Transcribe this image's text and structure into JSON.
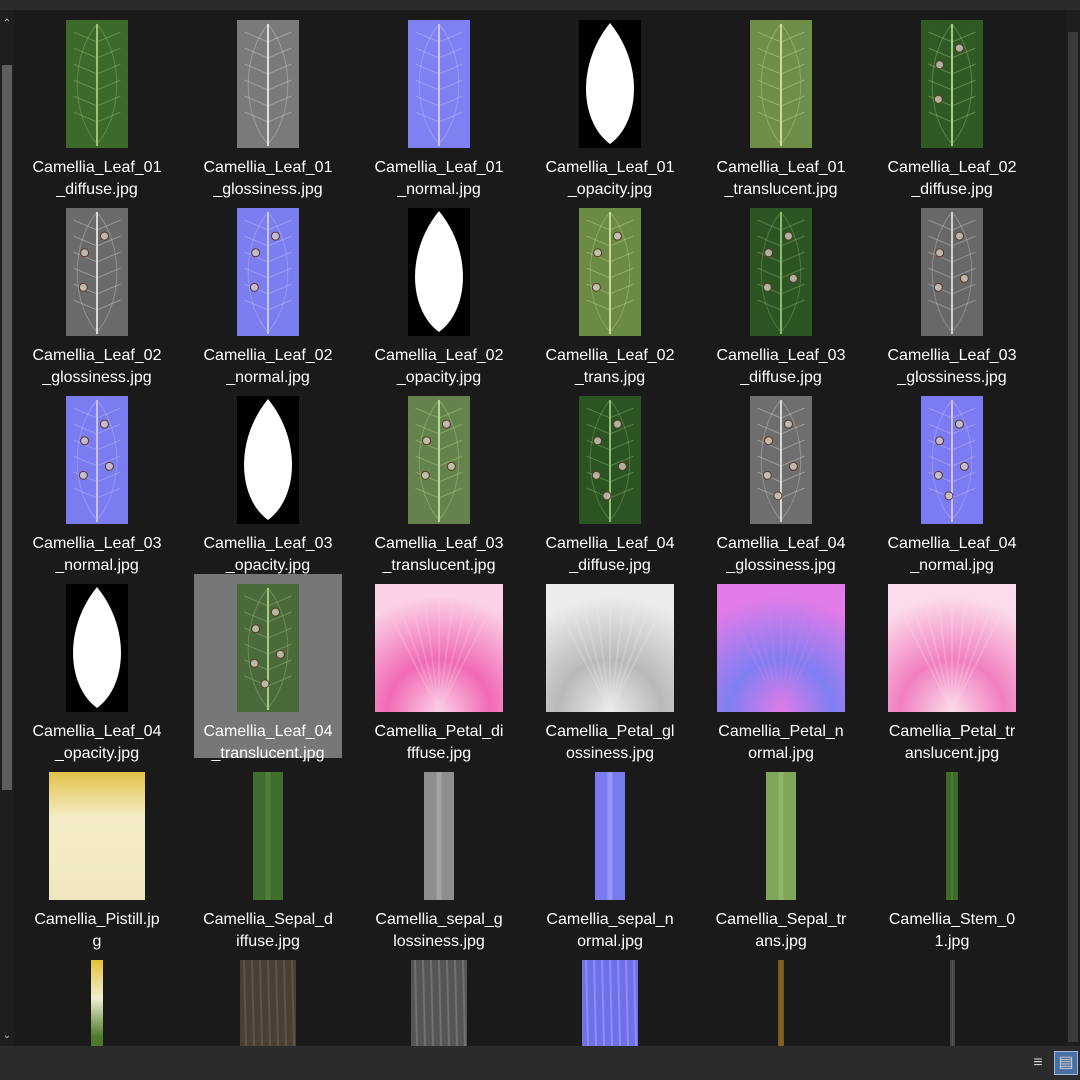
{
  "window": {
    "scroll_up_arrow": "^",
    "scroll_down_arrow": "v"
  },
  "files": [
    {
      "line1": "Camellia_Leaf_01",
      "line2": "_diffuse.jpg",
      "type": "leafrect",
      "bg": "#3b6a2a",
      "vein": "#9fc27a",
      "spots": 0
    },
    {
      "line1": "Camellia_Leaf_01",
      "line2": "_glossiness.jpg",
      "type": "leafrect",
      "bg": "#7a7a7a",
      "vein": "#dedede",
      "spots": 0
    },
    {
      "line1": "Camellia_Leaf_01",
      "line2": "_normal.jpg",
      "type": "leafrect",
      "bg": "#7f80f2",
      "vein": "#c8c8ff",
      "spots": 0
    },
    {
      "line1": "Camellia_Leaf_01",
      "line2": "_opacity.jpg",
      "type": "opacity",
      "bg": "#000000",
      "vein": "#ffffff",
      "spots": 0
    },
    {
      "line1": "Camellia_Leaf_01",
      "line2": "_translucent.jpg",
      "type": "leafrect",
      "bg": "#6f8e4a",
      "vein": "#c9dba0",
      "spots": 0
    },
    {
      "line1": "Camellia_Leaf_02",
      "line2": "_diffuse.jpg",
      "type": "leafrect",
      "bg": "#2f5a24",
      "vein": "#a9cf86",
      "spots": 3
    },
    {
      "line1": "Camellia_Leaf_02",
      "line2": "_glossiness.jpg",
      "type": "leafrect",
      "bg": "#6a6a6a",
      "vein": "#d8d8d8",
      "spots": 3
    },
    {
      "line1": "Camellia_Leaf_02",
      "line2": "_normal.jpg",
      "type": "leafrect",
      "bg": "#7c7ef0",
      "vein": "#c6c6ff",
      "spots": 3
    },
    {
      "line1": "Camellia_Leaf_02",
      "line2": "_opacity.jpg",
      "type": "opacity",
      "bg": "#000000",
      "vein": "#ffffff",
      "spots": 0
    },
    {
      "line1": "Camellia_Leaf_02",
      "line2": "_trans.jpg",
      "type": "leafrect",
      "bg": "#6b8a46",
      "vein": "#c6da9c",
      "spots": 3
    },
    {
      "line1": "Camellia_Leaf_03",
      "line2": "_diffuse.jpg",
      "type": "leafrect",
      "bg": "#2d5523",
      "vein": "#8fb872",
      "spots": 4
    },
    {
      "line1": "Camellia_Leaf_03",
      "line2": "_glossiness.jpg",
      "type": "leafrect",
      "bg": "#686868",
      "vein": "#d0d0d0",
      "spots": 4
    },
    {
      "line1": "Camellia_Leaf_03",
      "line2": "_normal.jpg",
      "type": "leafrect",
      "bg": "#7a7cf0",
      "vein": "#c3c4ff",
      "spots": 4
    },
    {
      "line1": "Camellia_Leaf_03",
      "line2": "_opacity.jpg",
      "type": "opacity",
      "bg": "#000000",
      "vein": "#ffffff",
      "spots": 0
    },
    {
      "line1": "Camellia_Leaf_03",
      "line2": "_translucent.jpg",
      "type": "leafrect",
      "bg": "#64834a",
      "vein": "#bcd59a",
      "spots": 4
    },
    {
      "line1": "Camellia_Leaf_04",
      "line2": "_diffuse.jpg",
      "type": "leafrect",
      "bg": "#2b5422",
      "vein": "#93bc74",
      "spots": 5
    },
    {
      "line1": "Camellia_Leaf_04",
      "line2": "_glossiness.jpg",
      "type": "leafrect",
      "bg": "#6e6e6e",
      "vein": "#d6d6d6",
      "spots": 5
    },
    {
      "line1": "Camellia_Leaf_04",
      "line2": "_normal.jpg",
      "type": "leafrect",
      "bg": "#7b7cf1",
      "vein": "#d0c0ff",
      "spots": 5
    },
    {
      "line1": "Camellia_Leaf_04",
      "line2": "_opacity.jpg",
      "type": "opacity",
      "bg": "#000000",
      "vein": "#ffffff",
      "spots": 0
    },
    {
      "line1": "Camellia_Leaf_04",
      "line2": "_translucent.jpg",
      "type": "leafrect",
      "bg": "#4a6a3a",
      "vein": "#a7c985",
      "spots": 5,
      "selected": true
    },
    {
      "line1": "Camellia_Petal_di",
      "line2": "fffuse.jpg",
      "type": "petal",
      "bg": "#f06ab4",
      "vein": "#fcd0e6",
      "spots": 0
    },
    {
      "line1": "Camellia_Petal_gl",
      "line2": "ossiness.jpg",
      "type": "petal",
      "bg": "#b9b9b9",
      "vein": "#ececec",
      "spots": 0
    },
    {
      "line1": "Camellia_Petal_n",
      "line2": "ormal.jpg",
      "type": "petal",
      "bg": "#7f7ff2",
      "vein": "#e07be8",
      "spots": 0
    },
    {
      "line1": "Camellia_Petal_tr",
      "line2": "anslucent.jpg",
      "type": "petal",
      "bg": "#f17fc0",
      "vein": "#fcdcea",
      "spots": 0
    },
    {
      "line1": "Camellia_Pistill.jp",
      "line2": "g",
      "type": "pistil",
      "bg": "#efe8bf",
      "vein": "#e2c24a",
      "spots": 0
    },
    {
      "line1": "Camellia_Sepal_d",
      "line2": "iffuse.jpg",
      "type": "strip",
      "w": 30,
      "bg": "#3f6d2f",
      "vein": "#5e8e46",
      "spots": 0
    },
    {
      "line1": "Camellia_sepal_g",
      "line2": "lossiness.jpg",
      "type": "strip",
      "w": 30,
      "bg": "#8e8e8e",
      "vein": "#b0b0b0",
      "spots": 0
    },
    {
      "line1": "Camellia_sepal_n",
      "line2": "ormal.jpg",
      "type": "strip",
      "w": 30,
      "bg": "#7b7bf0",
      "vein": "#a8a8ff",
      "spots": 0
    },
    {
      "line1": "Camellia_Sepal_tr",
      "line2": "ans.jpg",
      "type": "strip",
      "w": 30,
      "bg": "#7fa65a",
      "vein": "#9cc078",
      "spots": 0
    },
    {
      "line1": "Camellia_Stem_0",
      "line2": "1.jpg",
      "type": "strip",
      "w": 12,
      "bg": "#3f6a2a",
      "vein": "#5b8b3e",
      "spots": 0
    },
    {
      "line1": "",
      "line2": "",
      "type": "stemgrad",
      "w": 12,
      "bg": "#4b7a2c",
      "vein": "#e3c13a",
      "spots": 0
    },
    {
      "line1": "",
      "line2": "",
      "type": "bark",
      "w": 56,
      "bg": "#4a3f34",
      "vein": "#6b5d4e",
      "spots": 0
    },
    {
      "line1": "",
      "line2": "",
      "type": "bark",
      "w": 56,
      "bg": "#555555",
      "vein": "#7d7d7d",
      "spots": 0
    },
    {
      "line1": "",
      "line2": "",
      "type": "bark",
      "w": 56,
      "bg": "#7071e8",
      "vein": "#9a9bff",
      "spots": 0
    },
    {
      "line1": "",
      "line2": "",
      "type": "strip",
      "w": 6,
      "bg": "#7a5a1e",
      "vein": "#a07a2e",
      "spots": 0
    },
    {
      "line1": "",
      "line2": "",
      "type": "strip",
      "w": 5,
      "bg": "#444444",
      "vein": "#666666",
      "spots": 0
    }
  ],
  "statusbar": {
    "details_view_icon": "details-view-icon",
    "large_icons_view_icon": "large-icons-view-icon"
  }
}
